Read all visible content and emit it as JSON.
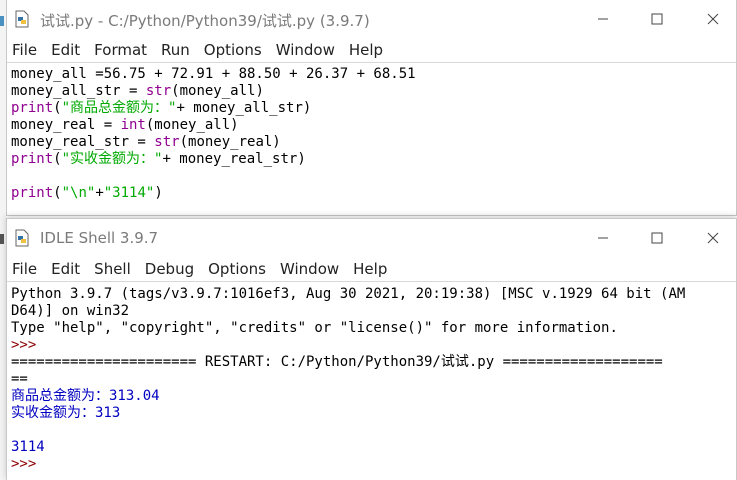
{
  "editor": {
    "title": "试试.py - C:/Python/Python39/试试.py (3.9.7)",
    "menu": [
      "File",
      "Edit",
      "Format",
      "Run",
      "Options",
      "Window",
      "Help"
    ],
    "lines": [
      [
        {
          "t": "money_all =56.75 + 72.91 + 88.50 + 26.37 + 68.51",
          "c": ""
        }
      ],
      [
        {
          "t": "money_all_str = ",
          "c": ""
        },
        {
          "t": "str",
          "c": "kw"
        },
        {
          "t": "(money_all)",
          "c": ""
        }
      ],
      [
        {
          "t": "print",
          "c": "kw"
        },
        {
          "t": "(",
          "c": ""
        },
        {
          "t": "\"商品总金额为：\"",
          "c": "str"
        },
        {
          "t": "+ money_all_str)",
          "c": ""
        }
      ],
      [
        {
          "t": "money_real = ",
          "c": ""
        },
        {
          "t": "int",
          "c": "kw"
        },
        {
          "t": "(money_all)",
          "c": ""
        }
      ],
      [
        {
          "t": "money_real_str = ",
          "c": ""
        },
        {
          "t": "str",
          "c": "kw"
        },
        {
          "t": "(money_real)",
          "c": ""
        }
      ],
      [
        {
          "t": "print",
          "c": "kw"
        },
        {
          "t": "(",
          "c": ""
        },
        {
          "t": "\"实收金额为：\"",
          "c": "str"
        },
        {
          "t": "+ money_real_str)",
          "c": ""
        }
      ],
      [
        {
          "t": "",
          "c": ""
        }
      ],
      [
        {
          "t": "print",
          "c": "kw"
        },
        {
          "t": "(",
          "c": ""
        },
        {
          "t": "\"\\n\"",
          "c": "str"
        },
        {
          "t": "+",
          "c": ""
        },
        {
          "t": "\"3114\"",
          "c": "str"
        },
        {
          "t": ")",
          "c": ""
        }
      ]
    ]
  },
  "shell": {
    "title": "IDLE Shell 3.9.7",
    "menu": [
      "File",
      "Edit",
      "Shell",
      "Debug",
      "Options",
      "Window",
      "Help"
    ],
    "lines": [
      [
        {
          "t": "Python 3.9.7 (tags/v3.9.7:1016ef3, Aug 30 2021, 20:19:38) [MSC v.1929 64 bit (AM",
          "c": ""
        }
      ],
      [
        {
          "t": "D64)] on win32",
          "c": ""
        }
      ],
      [
        {
          "t": "Type \"help\", \"copyright\", \"credits\" or \"license()\" for more information.",
          "c": ""
        }
      ],
      [
        {
          "t": ">>> ",
          "c": "prompt"
        }
      ],
      [
        {
          "t": "====================== RESTART: C:/Python/Python39/试试.py ===================",
          "c": "restart"
        }
      ],
      [
        {
          "t": "==",
          "c": "restart"
        }
      ],
      [
        {
          "t": "商品总金额为：313.04",
          "c": "out"
        }
      ],
      [
        {
          "t": "实收金额为：313",
          "c": "out"
        }
      ],
      [
        {
          "t": "",
          "c": ""
        }
      ],
      [
        {
          "t": "3114",
          "c": "out"
        }
      ],
      [
        {
          "t": ">>> ",
          "c": "prompt"
        }
      ]
    ]
  },
  "window_controls": {
    "minimize_icon": "minimize-icon",
    "maximize_icon": "maximize-icon",
    "close_icon": "close-icon"
  },
  "colors": {
    "keyword": "#900090",
    "string": "#00aa00",
    "output": "#0000c0",
    "prompt": "#8b0000"
  }
}
